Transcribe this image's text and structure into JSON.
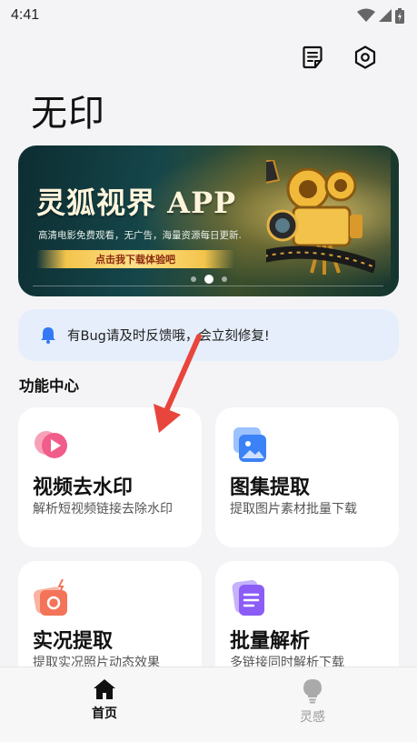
{
  "status_bar": {
    "time": "4:41",
    "icons": [
      "wifi-icon",
      "signal-icon",
      "battery-icon"
    ]
  },
  "header": {
    "title": "无印",
    "actions": [
      "notes-icon",
      "settings-icon"
    ]
  },
  "banner": {
    "headline": "灵狐视界 APP",
    "subtext": "高清电影免费观看，无广告，海量资源每日更新.",
    "cta": "点击我下载体验吧",
    "pages": 3,
    "active_page": 2
  },
  "notice": {
    "icon": "bell-icon",
    "text": "有Bug请及时反馈哦，会立刻修复!"
  },
  "section": {
    "title": "功能中心"
  },
  "features": [
    {
      "title": "视频去水印",
      "desc": "解析短视频链接去除水印",
      "icon": "video-play-icon",
      "color": "#f25c8a"
    },
    {
      "title": "图集提取",
      "desc": "提取图片素材批量下载",
      "icon": "gallery-icon",
      "color": "#3b82f6"
    },
    {
      "title": "实况提取",
      "desc": "提取实况照片动态效果",
      "icon": "live-photo-icon",
      "color": "#f4745a"
    },
    {
      "title": "批量解析",
      "desc": "多链接同时解析下载",
      "icon": "document-list-icon",
      "color": "#8b5cf6"
    }
  ],
  "tabs": [
    {
      "label": "首页",
      "icon": "home-icon",
      "active": true
    },
    {
      "label": "灵感",
      "icon": "lightbulb-icon",
      "active": false
    }
  ],
  "accent": "#e8453c"
}
